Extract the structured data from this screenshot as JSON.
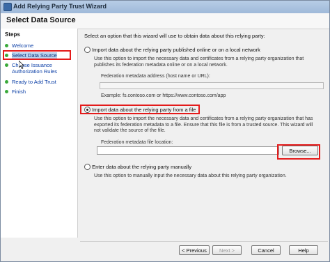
{
  "window": {
    "title": "Add Relying Party Trust Wizard"
  },
  "header": {
    "title": "Select Data Source"
  },
  "steps": {
    "heading": "Steps",
    "items": [
      {
        "label": "Welcome"
      },
      {
        "label": "Select Data Source",
        "selected": true
      },
      {
        "label": "Choose Issuance"
      },
      {
        "label": "Authorization Rules"
      },
      {
        "label": "Ready to Add Trust"
      },
      {
        "label": "Finish"
      }
    ]
  },
  "content": {
    "intro": "Select an option that this wizard will use to obtain data about this relying party:",
    "option_online": {
      "label": "Import data about the relying party published online or on a local network",
      "desc_line1": "Use this option to import the necessary data and certificates from a relying party organization that",
      "desc_line2": "publishes its federation metadata online or on a local network.",
      "field_label": "Federation metadata address (host name or URL):",
      "field_value": "",
      "example": "Example: fs.contoso.com or https://www.contoso.com/app"
    },
    "option_file": {
      "label": "Import data about the relying party from a file",
      "desc_line1": "Use this option to import the necessary data and certificates from a relying party organization that has",
      "desc_line2": "exported its federation metadata to a file. Ensure that this file is from a trusted source. This wizard will",
      "desc_line3": "not validate the source of the file.",
      "field_label": "Federation metadata file location:",
      "field_value": "",
      "browse_label": "Browse..."
    },
    "option_manual": {
      "label": "Enter data about the relying party manually",
      "desc": "Use this option to manually input the necessary data about this relying party organization."
    }
  },
  "footer": {
    "previous_label": "< Previous",
    "next_label": "Next >",
    "cancel_label": "Cancel",
    "help_label": "Help"
  },
  "colors": {
    "highlight": "#e41b1b",
    "step_dot": "#3aa93a",
    "link": "#0a3ea6"
  },
  "icons": [
    "app-icon",
    "step-dot-icon",
    "pointer-cursor-icon"
  ]
}
